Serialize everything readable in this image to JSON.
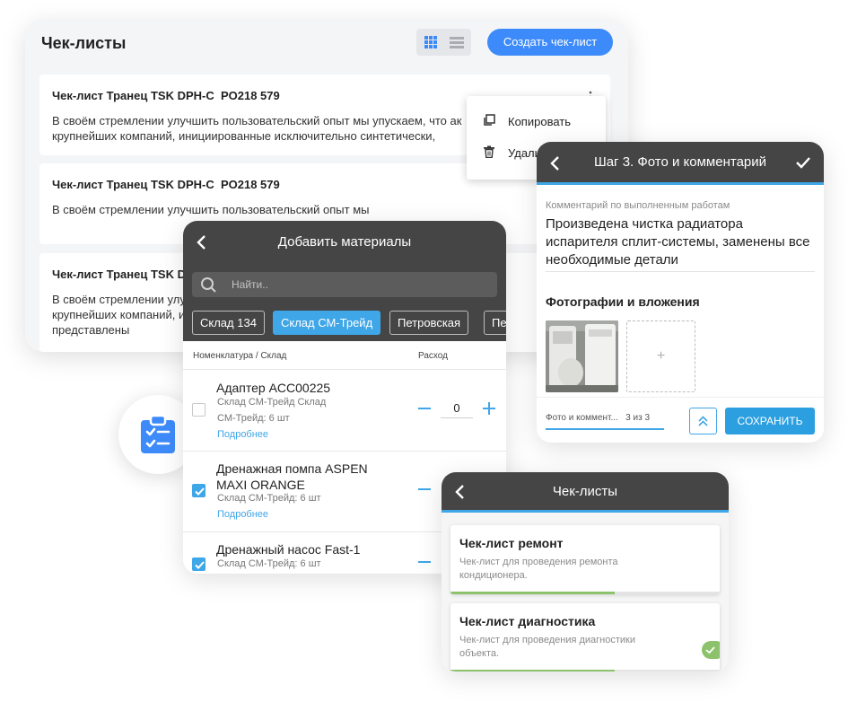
{
  "desktop": {
    "title": "Чек-листы",
    "create_button": "Создать чек-лист",
    "rows": [
      {
        "title": "Чек-лист Транец TSK DPH-C  PO218 579",
        "desc_lines": [
          "В своём стремлении улучшить пользовательский опыт мы упускаем, что ак",
          "крупнейших компаний, инициированные исключительно синтетически,"
        ]
      },
      {
        "title": "Чек-лист Транец TSK DPH-C  PO218 579",
        "desc_lines": [
          "В своём стремлении улучшить пользовательский опыт мы"
        ]
      },
      {
        "title": "Чек-лист Транец TSK DPH",
        "desc_lines": [
          "В своём стремлении улучшить",
          "крупнейших компаний, и",
          "представлены"
        ]
      }
    ],
    "context_menu": {
      "copy": "Копировать",
      "delete": "Удали"
    }
  },
  "materials": {
    "title": "Добавить материалы",
    "search_placeholder": "Найти..",
    "warehouses": [
      "Склад 134",
      "Склад СМ-Трейд",
      "Петровская",
      "Пе"
    ],
    "active_warehouse": 1,
    "col_name": "Номенклатура / Склад",
    "col_qty": "Расход",
    "items": [
      {
        "name": "Адаптер ACC00225",
        "warehouse": "Склад СМ-Трейд Склад",
        "stock": "СМ-Трейд: 6 шт",
        "more": "Подробнее",
        "qty": "0",
        "checked": false
      },
      {
        "name": "Дренажная помпа ASPEN MAXI ORANGE",
        "warehouse": "Склад СМ-Трейд: 6 шт",
        "more": "Подробнее",
        "checked": true
      },
      {
        "name": "Дренажный насос Fast-1",
        "warehouse": "Склад СМ-Трейд: 6 шт",
        "checked": true
      }
    ]
  },
  "step3": {
    "title": "Шаг 3. Фото и комментарий",
    "comment_label": "Комментарий по выполненным работам",
    "comment_text": "Произведена чистка радиатора испарителя сплит-системы, заменены все необходимые детали",
    "photos_heading": "Фотографии и вложения",
    "add_symbol": "+",
    "footer_tab": "Фото и коммент...",
    "footer_counter": "3 из 3",
    "save_button": "СОХРАНИТЬ"
  },
  "checklists": {
    "title": "Чек-листы",
    "items": [
      {
        "title": "Чек-лист ремонт",
        "desc": "Чек-лист для проведения ремонта кондиционера.",
        "progress": 0.61,
        "done": false
      },
      {
        "title": "Чек-лист диагностика",
        "desc": "Чек-лист для проведения диагностики объекта.",
        "progress": 0.61,
        "done": true
      }
    ]
  },
  "colors": {
    "accent_blue": "#3fa6e8",
    "button_blue": "#3d8bfa",
    "header_dark": "#454545",
    "progress_green": "#8cc26b"
  },
  "icons": [
    "grid-view-icon",
    "list-view-icon",
    "kebab-menu-icon",
    "copy-icon",
    "trash-icon",
    "back-arrow-icon",
    "checkmark-icon",
    "search-icon",
    "clipboard-checklist-icon",
    "collapse-up-icon"
  ]
}
